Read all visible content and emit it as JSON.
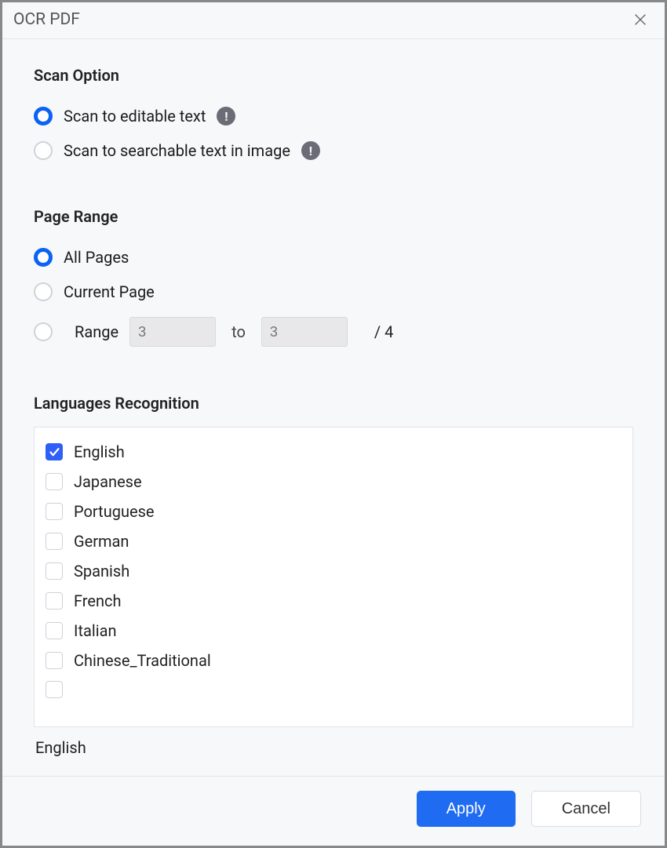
{
  "header": {
    "title": "OCR PDF"
  },
  "scanOption": {
    "title": "Scan Option",
    "options": [
      {
        "label": "Scan to editable text",
        "selected": true
      },
      {
        "label": "Scan to searchable text in image",
        "selected": false
      }
    ]
  },
  "pageRange": {
    "title": "Page Range",
    "allPages": {
      "label": "All Pages",
      "selected": true
    },
    "currentPage": {
      "label": "Current Page",
      "selected": false
    },
    "range": {
      "label": "Range",
      "selected": false,
      "from": "3",
      "toLabel": "to",
      "to": "3",
      "totalLabel": "/ 4"
    }
  },
  "languages": {
    "title": "Languages Recognition",
    "items": [
      {
        "label": "English",
        "checked": true
      },
      {
        "label": "Japanese",
        "checked": false
      },
      {
        "label": "Portuguese",
        "checked": false
      },
      {
        "label": "German",
        "checked": false
      },
      {
        "label": "Spanish",
        "checked": false
      },
      {
        "label": "French",
        "checked": false
      },
      {
        "label": "Italian",
        "checked": false
      },
      {
        "label": "Chinese_Traditional",
        "checked": false
      },
      {
        "label": "",
        "checked": false
      }
    ],
    "selectedSummary": "English"
  },
  "footer": {
    "apply": "Apply",
    "cancel": "Cancel"
  }
}
